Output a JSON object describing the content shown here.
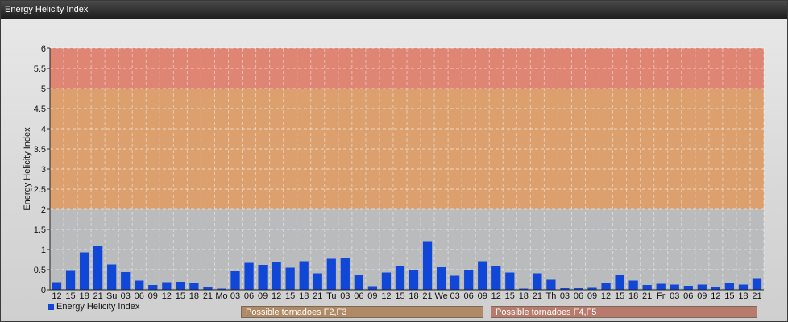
{
  "window": {
    "title": "Energy Helicity Index"
  },
  "colors": {
    "bar": "#1147d6",
    "zone_low": "#b9bbbd",
    "zone_mid": "#dba06e",
    "zone_high": "#de8673",
    "legend_mid": "#b08a66",
    "legend_high": "#b87a6c"
  },
  "chart_data": {
    "type": "bar",
    "title": "",
    "ylabel": "Energy Helicity Index",
    "xlabel": "",
    "ylim": [
      0,
      6
    ],
    "yticks": [
      "0",
      "0.5",
      "1",
      "1.5",
      "2",
      "2.5",
      "3",
      "3.5",
      "4",
      "4.5",
      "5",
      "5.5",
      "6"
    ],
    "grid": true,
    "categories": [
      "12",
      "15",
      "18",
      "21",
      "Su",
      "03",
      "06",
      "09",
      "12",
      "15",
      "18",
      "21",
      "Mo",
      "03",
      "06",
      "09",
      "12",
      "15",
      "18",
      "21",
      "Tu",
      "03",
      "06",
      "09",
      "12",
      "15",
      "18",
      "21",
      "We",
      "03",
      "06",
      "09",
      "12",
      "15",
      "18",
      "21",
      "Th",
      "03",
      "06",
      "09",
      "12",
      "15",
      "18",
      "21",
      "Fr",
      "03",
      "06",
      "09",
      "12",
      "15",
      "18",
      "21"
    ],
    "series": [
      {
        "name": "Energy Helicity Index",
        "values": [
          0.19,
          0.47,
          0.93,
          1.09,
          0.63,
          0.44,
          0.23,
          0.12,
          0.19,
          0.2,
          0.16,
          0.06,
          0.03,
          0.46,
          0.67,
          0.62,
          0.68,
          0.55,
          0.71,
          0.41,
          0.77,
          0.79,
          0.36,
          0.09,
          0.43,
          0.58,
          0.49,
          1.21,
          0.56,
          0.35,
          0.48,
          0.71,
          0.58,
          0.43,
          0.03,
          0.41,
          0.25,
          0.04,
          0.04,
          0.05,
          0.17,
          0.36,
          0.23,
          0.12,
          0.15,
          0.13,
          0.1,
          0.13,
          0.08,
          0.16,
          0.13,
          0.29
        ]
      }
    ],
    "zones": [
      {
        "from": 2,
        "to": 5,
        "label": "Possible tornadoes F2,F3"
      },
      {
        "from": 5,
        "to": 6,
        "label": "Possible tornadoes F4,F5"
      }
    ],
    "legend": "bottom-left"
  }
}
